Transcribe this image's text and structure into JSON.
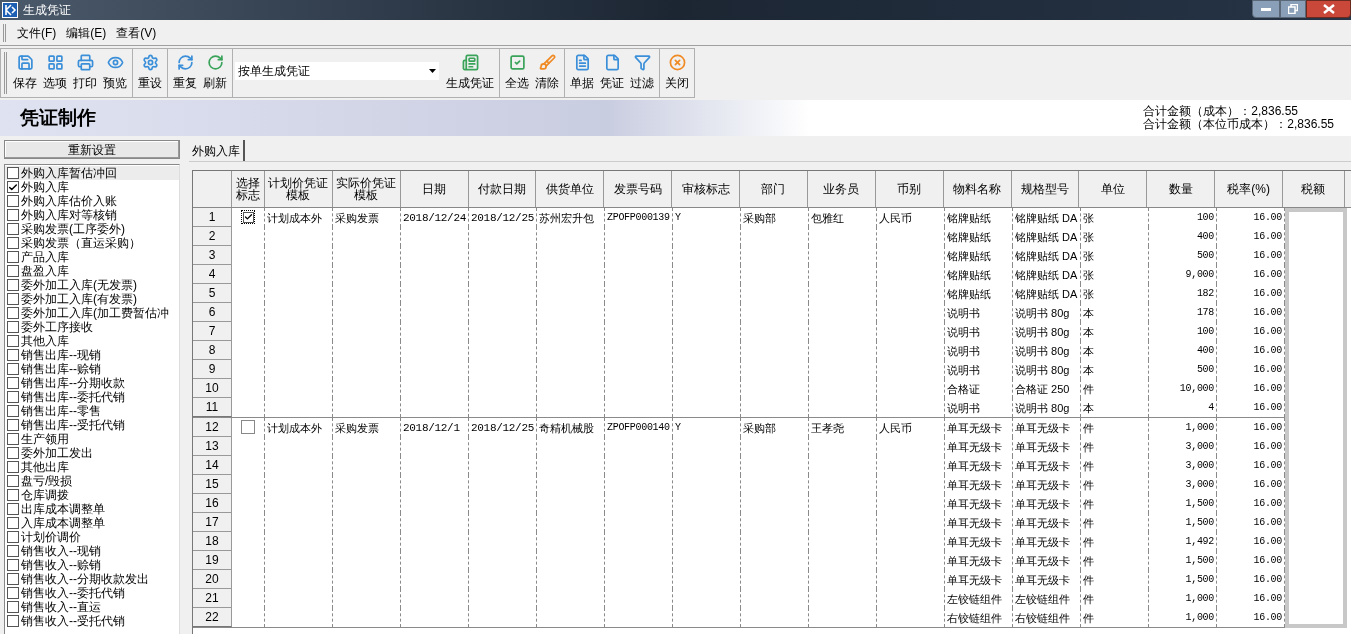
{
  "window": {
    "title": "生成凭证"
  },
  "menu": [
    "文件(F)",
    "编辑(E)",
    "查看(V)"
  ],
  "toolbar_groups": [
    [
      {
        "kind": "button",
        "label": "保存"
      },
      {
        "kind": "button",
        "label": "选项"
      },
      {
        "kind": "button",
        "label": "打印"
      },
      {
        "kind": "button",
        "label": "预览"
      }
    ],
    [
      {
        "kind": "button",
        "label": "重设"
      }
    ],
    [
      {
        "kind": "button",
        "label": "重复"
      },
      {
        "kind": "button",
        "label": "刷新"
      }
    ],
    [
      {
        "kind": "dropdown",
        "value": "按单生成凭证"
      },
      {
        "kind": "button",
        "label": "生成凭证"
      }
    ],
    [
      {
        "kind": "button",
        "label": "全选"
      },
      {
        "kind": "button",
        "label": "清除"
      }
    ],
    [
      {
        "kind": "button",
        "label": "单据"
      },
      {
        "kind": "button",
        "label": "凭证"
      },
      {
        "kind": "button",
        "label": "过滤"
      }
    ],
    [
      {
        "kind": "button",
        "label": "关闭"
      }
    ]
  ],
  "banner": {
    "title": "凭证制作",
    "totals": [
      "合计金额（成本）：2,836.55",
      "合计金额（本位币成本）：2,836.55"
    ]
  },
  "reset_button": "重新设置",
  "doc_types": [
    {
      "label": "外购入库暂估冲回",
      "checked": false,
      "focused": true
    },
    {
      "label": "外购入库",
      "checked": true,
      "focused": false
    },
    {
      "label": "外购入库估价入账",
      "checked": false,
      "focused": false
    },
    {
      "label": "外购入库对等核销",
      "checked": false,
      "focused": false
    },
    {
      "label": "采购发票(工序委外)",
      "checked": false,
      "focused": false
    },
    {
      "label": "采购发票（直运采购）",
      "checked": false,
      "focused": false
    },
    {
      "label": "产品入库",
      "checked": false,
      "focused": false
    },
    {
      "label": "盘盈入库",
      "checked": false,
      "focused": false
    },
    {
      "label": "委外加工入库(无发票)",
      "checked": false,
      "focused": false
    },
    {
      "label": "委外加工入库(有发票)",
      "checked": false,
      "focused": false
    },
    {
      "label": "委外加工入库(加工费暂估冲",
      "checked": false,
      "focused": false
    },
    {
      "label": "委外工序接收",
      "checked": false,
      "focused": false
    },
    {
      "label": "其他入库",
      "checked": false,
      "focused": false
    },
    {
      "label": "销售出库--现销",
      "checked": false,
      "focused": false
    },
    {
      "label": "销售出库--赊销",
      "checked": false,
      "focused": false
    },
    {
      "label": "销售出库--分期收款",
      "checked": false,
      "focused": false
    },
    {
      "label": "销售出库--委托代销",
      "checked": false,
      "focused": false
    },
    {
      "label": "销售出库--零售",
      "checked": false,
      "focused": false
    },
    {
      "label": "销售出库--受托代销",
      "checked": false,
      "focused": false
    },
    {
      "label": "生产领用",
      "checked": false,
      "focused": false
    },
    {
      "label": "委外加工发出",
      "checked": false,
      "focused": false
    },
    {
      "label": "其他出库",
      "checked": false,
      "focused": false
    },
    {
      "label": "盘亏/毁损",
      "checked": false,
      "focused": false
    },
    {
      "label": "仓库调拨",
      "checked": false,
      "focused": false
    },
    {
      "label": "出库成本调整单",
      "checked": false,
      "focused": false
    },
    {
      "label": "入库成本调整单",
      "checked": false,
      "focused": false
    },
    {
      "label": "计划价调价",
      "checked": false,
      "focused": false
    },
    {
      "label": "销售收入--现销",
      "checked": false,
      "focused": false
    },
    {
      "label": "销售收入--赊销",
      "checked": false,
      "focused": false
    },
    {
      "label": "销售收入--分期收款发出",
      "checked": false,
      "focused": false
    },
    {
      "label": "销售收入--委托代销",
      "checked": false,
      "focused": false
    },
    {
      "label": "销售收入--直运",
      "checked": false,
      "focused": false
    },
    {
      "label": "销售收入--受托代销",
      "checked": false,
      "focused": false
    }
  ],
  "tabs": [
    {
      "label": "外购入库",
      "selected": true
    }
  ],
  "table": {
    "columns": [
      "选择标志",
      "计划价凭证模板",
      "实际价凭证模板",
      "日期",
      "付款日期",
      "供货单位",
      "发票号码",
      "审核标志",
      "部门",
      "业务员",
      "币别",
      "物料名称",
      "规格型号",
      "单位",
      "数量",
      "税率(%)",
      "税额"
    ],
    "groups": [
      {
        "checked": true,
        "plan_template": "计划成本外",
        "actual_template": "采购发票",
        "date": "2018/12/24",
        "pay_date": "2018/12/25",
        "supplier": "苏州宏升包",
        "invoice_no": "ZPOFP000139",
        "audit": "Y",
        "dept": "采购部",
        "clerk": "包雅红",
        "currency": "人民币",
        "lines": [
          {
            "no": "1",
            "material": "铭牌贴纸",
            "spec": "铭牌贴纸 DA",
            "unit": "张",
            "qty": "100",
            "tax_rate": "16.00"
          },
          {
            "no": "2",
            "material": "铭牌贴纸",
            "spec": "铭牌贴纸 DA",
            "unit": "张",
            "qty": "400",
            "tax_rate": "16.00"
          },
          {
            "no": "3",
            "material": "铭牌贴纸",
            "spec": "铭牌贴纸 DA",
            "unit": "张",
            "qty": "500",
            "tax_rate": "16.00"
          },
          {
            "no": "4",
            "material": "铭牌贴纸",
            "spec": "铭牌贴纸 DA",
            "unit": "张",
            "qty": "9,000",
            "tax_rate": "16.00"
          },
          {
            "no": "5",
            "material": "铭牌贴纸",
            "spec": "铭牌贴纸 DA",
            "unit": "张",
            "qty": "182",
            "tax_rate": "16.00"
          },
          {
            "no": "6",
            "material": "说明书",
            "spec": "说明书 80g",
            "unit": "本",
            "qty": "178",
            "tax_rate": "16.00"
          },
          {
            "no": "7",
            "material": "说明书",
            "spec": "说明书 80g",
            "unit": "本",
            "qty": "100",
            "tax_rate": "16.00"
          },
          {
            "no": "8",
            "material": "说明书",
            "spec": "说明书 80g",
            "unit": "本",
            "qty": "400",
            "tax_rate": "16.00"
          },
          {
            "no": "9",
            "material": "说明书",
            "spec": "说明书 80g",
            "unit": "本",
            "qty": "500",
            "tax_rate": "16.00"
          },
          {
            "no": "10",
            "material": "合格证",
            "spec": "合格证 250",
            "unit": "件",
            "qty": "10,000",
            "tax_rate": "16.00"
          },
          {
            "no": "11",
            "material": "说明书",
            "spec": "说明书 80g",
            "unit": "本",
            "qty": "4",
            "tax_rate": "16.00"
          }
        ]
      },
      {
        "checked": false,
        "plan_template": "计划成本外",
        "actual_template": "采购发票",
        "date": "2018/12/1",
        "pay_date": "2018/12/25",
        "supplier": "奇精机械股",
        "invoice_no": "ZPOFP000140",
        "audit": "Y",
        "dept": "采购部",
        "clerk": "王孝尧",
        "currency": "人民币",
        "lines": [
          {
            "no": "12",
            "material": "单耳无级卡",
            "spec": "单耳无级卡",
            "unit": "件",
            "qty": "1,000",
            "tax_rate": "16.00"
          },
          {
            "no": "13",
            "material": "单耳无级卡",
            "spec": "单耳无级卡",
            "unit": "件",
            "qty": "3,000",
            "tax_rate": "16.00"
          },
          {
            "no": "14",
            "material": "单耳无级卡",
            "spec": "单耳无级卡",
            "unit": "件",
            "qty": "3,000",
            "tax_rate": "16.00"
          },
          {
            "no": "15",
            "material": "单耳无级卡",
            "spec": "单耳无级卡",
            "unit": "件",
            "qty": "3,000",
            "tax_rate": "16.00"
          },
          {
            "no": "16",
            "material": "单耳无级卡",
            "spec": "单耳无级卡",
            "unit": "件",
            "qty": "1,500",
            "tax_rate": "16.00"
          },
          {
            "no": "17",
            "material": "单耳无级卡",
            "spec": "单耳无级卡",
            "unit": "件",
            "qty": "1,500",
            "tax_rate": "16.00"
          },
          {
            "no": "18",
            "material": "单耳无级卡",
            "spec": "单耳无级卡",
            "unit": "件",
            "qty": "1,492",
            "tax_rate": "16.00"
          },
          {
            "no": "19",
            "material": "单耳无级卡",
            "spec": "单耳无级卡",
            "unit": "件",
            "qty": "1,500",
            "tax_rate": "16.00"
          },
          {
            "no": "20",
            "material": "单耳无级卡",
            "spec": "单耳无级卡",
            "unit": "件",
            "qty": "1,500",
            "tax_rate": "16.00"
          },
          {
            "no": "21",
            "material": "左铰链组件",
            "spec": "左铰链组件",
            "unit": "件",
            "qty": "1,000",
            "tax_rate": "16.00"
          },
          {
            "no": "22",
            "material": "右铰链组件",
            "spec": "右铰链组件",
            "unit": "件",
            "qty": "1,000",
            "tax_rate": "16.00"
          }
        ]
      }
    ]
  }
}
